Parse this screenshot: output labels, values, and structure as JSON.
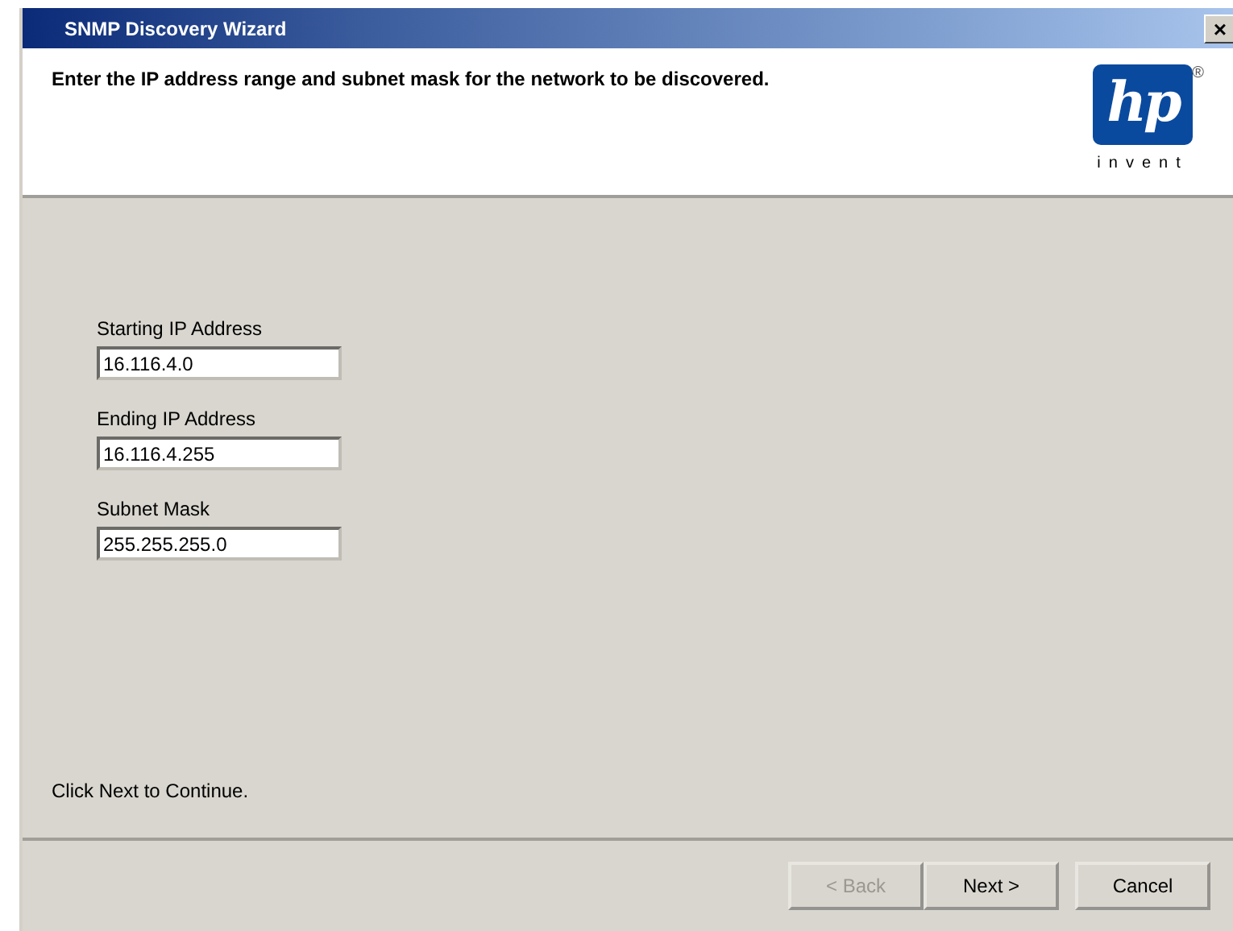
{
  "window": {
    "title": "SNMP Discovery Wizard",
    "close": "×"
  },
  "header": {
    "instruction": "Enter the IP address range and subnet mask for the network to be discovered.",
    "logo": {
      "mark": "hp",
      "registered": "®",
      "tagline": "invent"
    }
  },
  "fields": [
    {
      "label": "Starting IP Address",
      "value": "16.116.4.0"
    },
    {
      "label": "Ending IP Address",
      "value": "16.116.4.255"
    },
    {
      "label": "Subnet Mask",
      "value": "255.255.255.0"
    }
  ],
  "hint": "Click Next to Continue.",
  "buttons": [
    {
      "label": "< Back",
      "disabled": true
    },
    {
      "label": "Next >",
      "disabled": false
    },
    {
      "label": "Cancel",
      "disabled": false
    }
  ]
}
